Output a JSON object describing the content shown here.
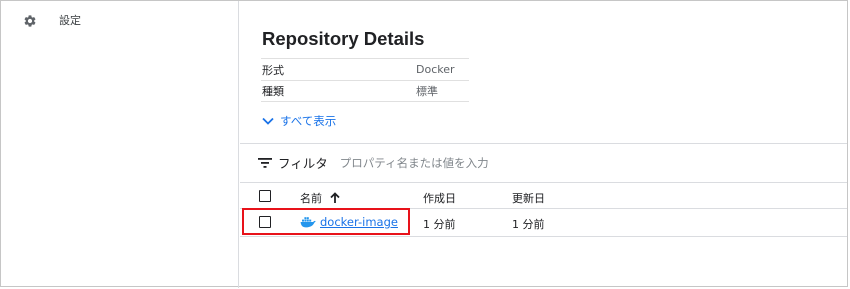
{
  "sidebar": {
    "items": [
      {
        "label": "設定",
        "icon": "gear-icon"
      }
    ]
  },
  "repository": {
    "title": "Repository Details",
    "details": [
      {
        "key": "形式",
        "value": "Docker"
      },
      {
        "key": "種類",
        "value": "標準"
      }
    ],
    "show_all_label": "すべて表示"
  },
  "filter": {
    "label": "フィルタ",
    "placeholder": "プロパティ名または値を入力"
  },
  "table": {
    "columns": {
      "name": "名前",
      "created": "作成日",
      "updated": "更新日"
    },
    "sort": "ascending",
    "rows": [
      {
        "name": "docker-image",
        "created": "1 分前",
        "updated": "1 分前",
        "icon": "docker-icon"
      }
    ]
  },
  "colors": {
    "link": "#1a73e8",
    "highlight": "#e8121a"
  }
}
